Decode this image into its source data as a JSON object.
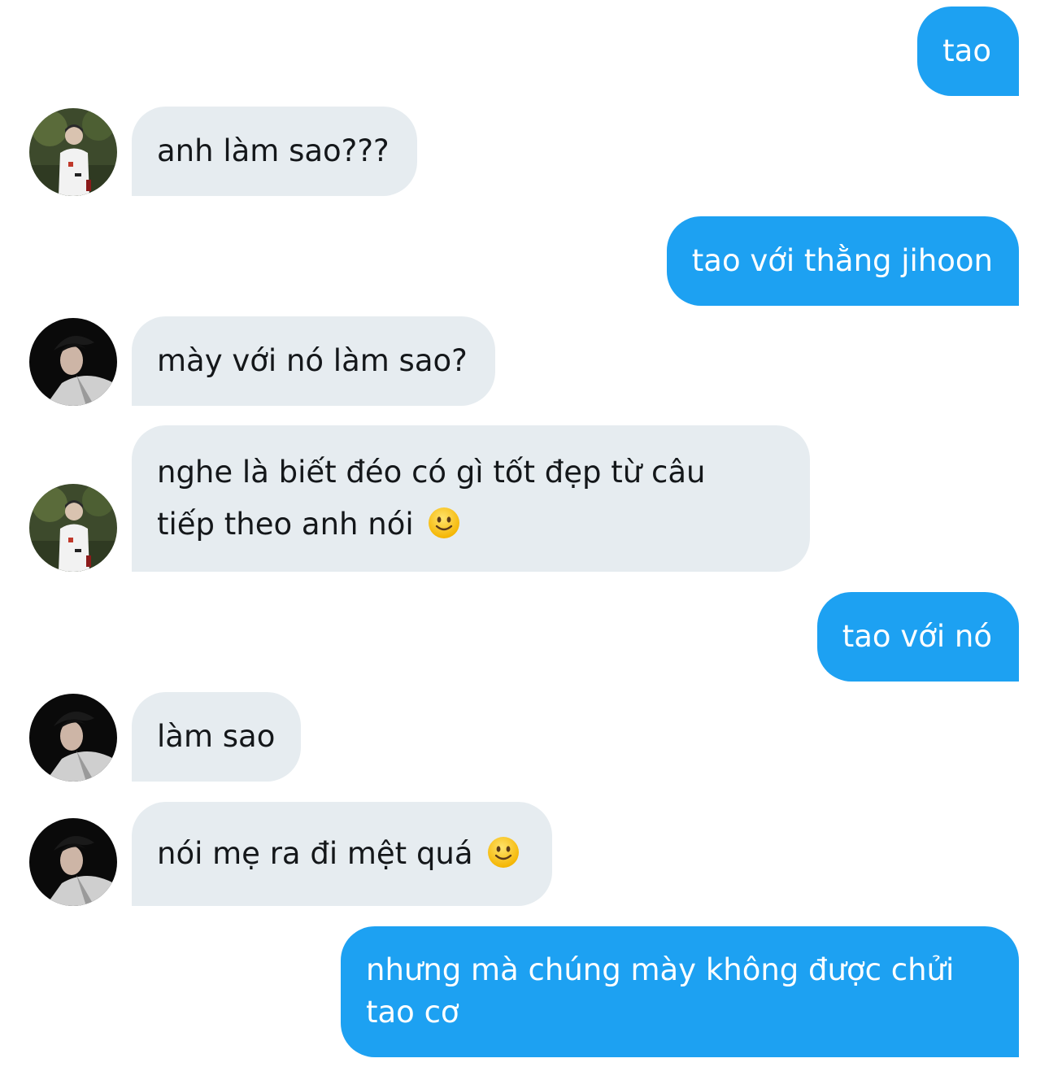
{
  "conversation": {
    "messages": [
      {
        "sender": "me",
        "text": "tao"
      },
      {
        "sender": "other",
        "text": "anh làm sao???",
        "avatar": "avatar-b"
      },
      {
        "sender": "me",
        "text": "tao với thằng jihoon"
      },
      {
        "sender": "other",
        "text": "mày với nó làm sao?",
        "avatar": "avatar-a"
      },
      {
        "sender": "other",
        "text": "nghe là biết đéo có gì tốt đẹp từ câu tiếp theo anh nói",
        "avatar": "avatar-b",
        "emoji": "slightly-smiling-face-emoji"
      },
      {
        "sender": "me",
        "text": "tao với nó"
      },
      {
        "sender": "other",
        "text": "làm sao",
        "avatar": "avatar-a"
      },
      {
        "sender": "other",
        "text": "nói mẹ ra đi mệt quá",
        "avatar": "avatar-a",
        "emoji": "slightly-smiling-face-emoji"
      },
      {
        "sender": "me",
        "text": "nhưng mà chúng mày không được chửi tao cơ"
      }
    ]
  },
  "colors": {
    "sent_bubble": "#1da1f2",
    "received_bubble": "#e6ecf0",
    "received_text": "#14171a",
    "sent_text": "#ffffff",
    "background": "#ffffff"
  }
}
